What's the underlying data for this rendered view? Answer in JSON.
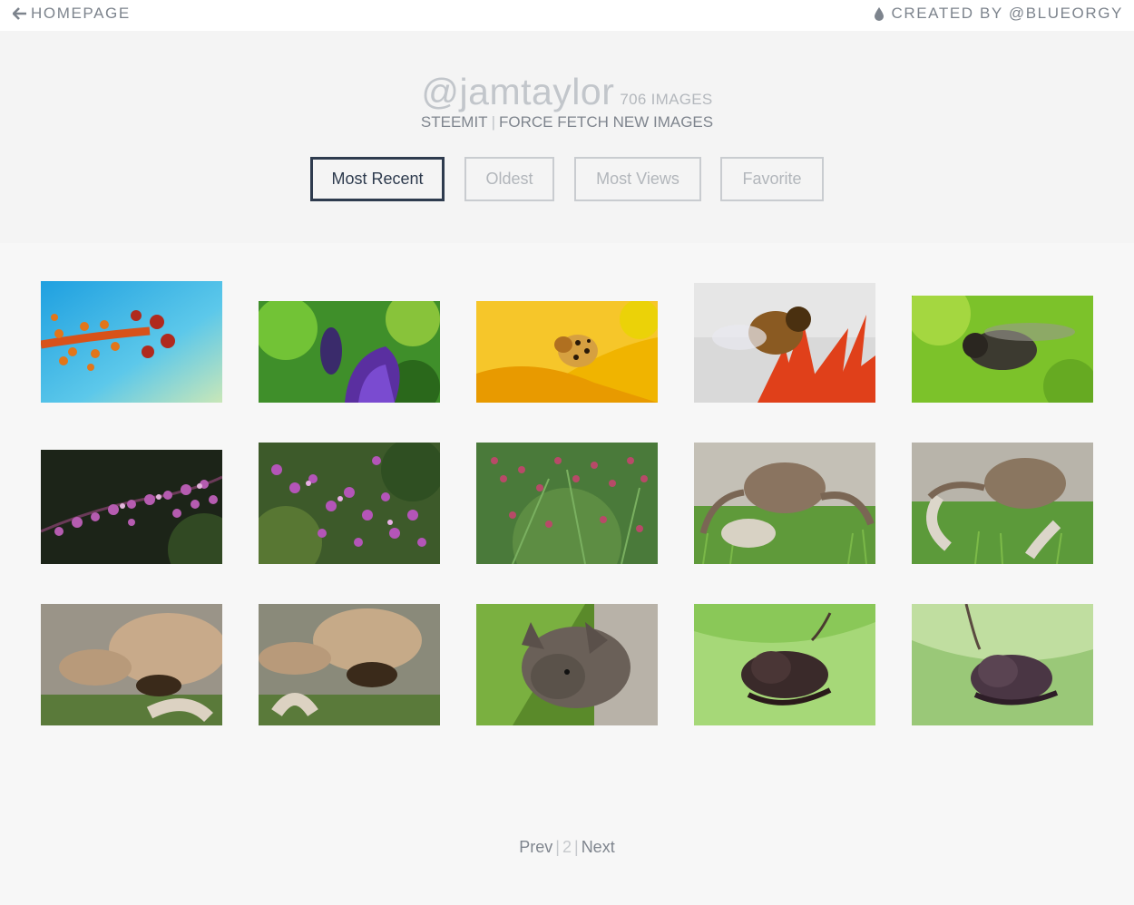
{
  "nav": {
    "home_label": "HOMEPAGE",
    "credit_label": "CREATED BY @BLUEORGY"
  },
  "profile": {
    "username": "@jamtaylor",
    "image_count": "706 IMAGES",
    "platform_link": "STEEMIT",
    "separator": "|",
    "fetch_link": "FORCE FETCH NEW IMAGES"
  },
  "sort": {
    "most_recent": "Most Recent",
    "oldest": "Oldest",
    "most_views": "Most Views",
    "favorite": "Favorite",
    "active": "Most Recent"
  },
  "gallery": [
    {
      "subject": "orange stamen on blue"
    },
    {
      "subject": "purple bud on green"
    },
    {
      "subject": "ladybug on yellow petal"
    },
    {
      "subject": "bee on red flower"
    },
    {
      "subject": "fly on green leaf"
    },
    {
      "subject": "pink blossoms dark"
    },
    {
      "subject": "pink blossoms green"
    },
    {
      "subject": "pink blossoms ferns"
    },
    {
      "subject": "crab on grass"
    },
    {
      "subject": "crab on grass close"
    },
    {
      "subject": "crab closeup 1"
    },
    {
      "subject": "crab closeup 2"
    },
    {
      "subject": "bat face"
    },
    {
      "subject": "bat on leaf"
    },
    {
      "subject": "bat on leaf pale"
    }
  ],
  "pager": {
    "prev": "Prev",
    "sep1": "|",
    "page": "2",
    "sep2": "|",
    "next": "Next"
  },
  "colors": {
    "active_border": "#2e3b4e",
    "inactive_border": "#c9ccd0",
    "background": "#f7f7f7"
  }
}
